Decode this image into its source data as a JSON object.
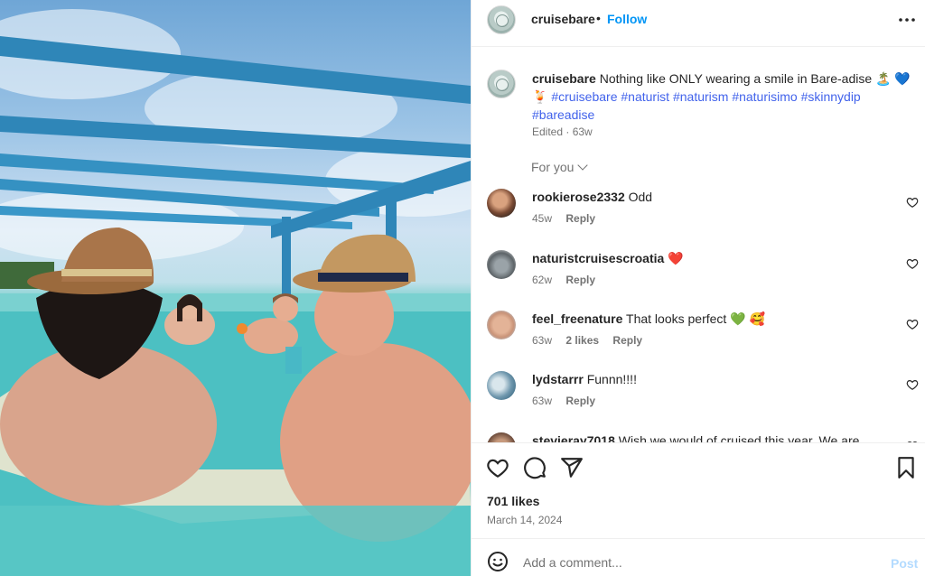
{
  "post": {
    "username": "cruisebare",
    "separator": "•",
    "follow_label": "Follow",
    "more_label": "•••"
  },
  "caption": {
    "username": "cruisebare",
    "text": "Nothing like ONLY wearing a smile in Bare-adise 🏝️ 💙",
    "text2": "🍹",
    "hashtags": "#cruisebare #naturist #naturism #naturisimo #skinnydip #bareadise",
    "meta": "Edited · 63w"
  },
  "for_you_label": "For you",
  "comments": [
    {
      "username": "rookierose2332",
      "text": "Odd",
      "time": "45w",
      "likes": "",
      "reply": "Reply"
    },
    {
      "username": "naturistcruisescroatia",
      "text": "❤️",
      "time": "62w",
      "likes": "",
      "reply": "Reply"
    },
    {
      "username": "feel_freenature",
      "text": "That looks perfect 💚 🥰",
      "time": "63w",
      "likes": "2 likes",
      "reply": "Reply"
    },
    {
      "username": "lydstarrr",
      "text": "Funnn!!!!",
      "time": "63w",
      "likes": "",
      "reply": "Reply"
    },
    {
      "username": "stevieray7018",
      "text": "Wish we would of cruised this year. We are",
      "time": "",
      "likes": "",
      "reply": ""
    }
  ],
  "icons": {
    "like": "heart-icon",
    "comment": "comment-icon",
    "share": "share-icon",
    "save": "bookmark-icon",
    "emoji": "emoji-icon",
    "more": "more-icon"
  },
  "likes_count": "701 likes",
  "date": "March 14, 2024",
  "add_comment": {
    "placeholder": "Add a comment...",
    "post_label": "Post"
  },
  "colors": {
    "follow": "#0095f6",
    "hashtag": "#4263eb",
    "post_disabled": "#b3dbff",
    "muted": "#737373"
  }
}
